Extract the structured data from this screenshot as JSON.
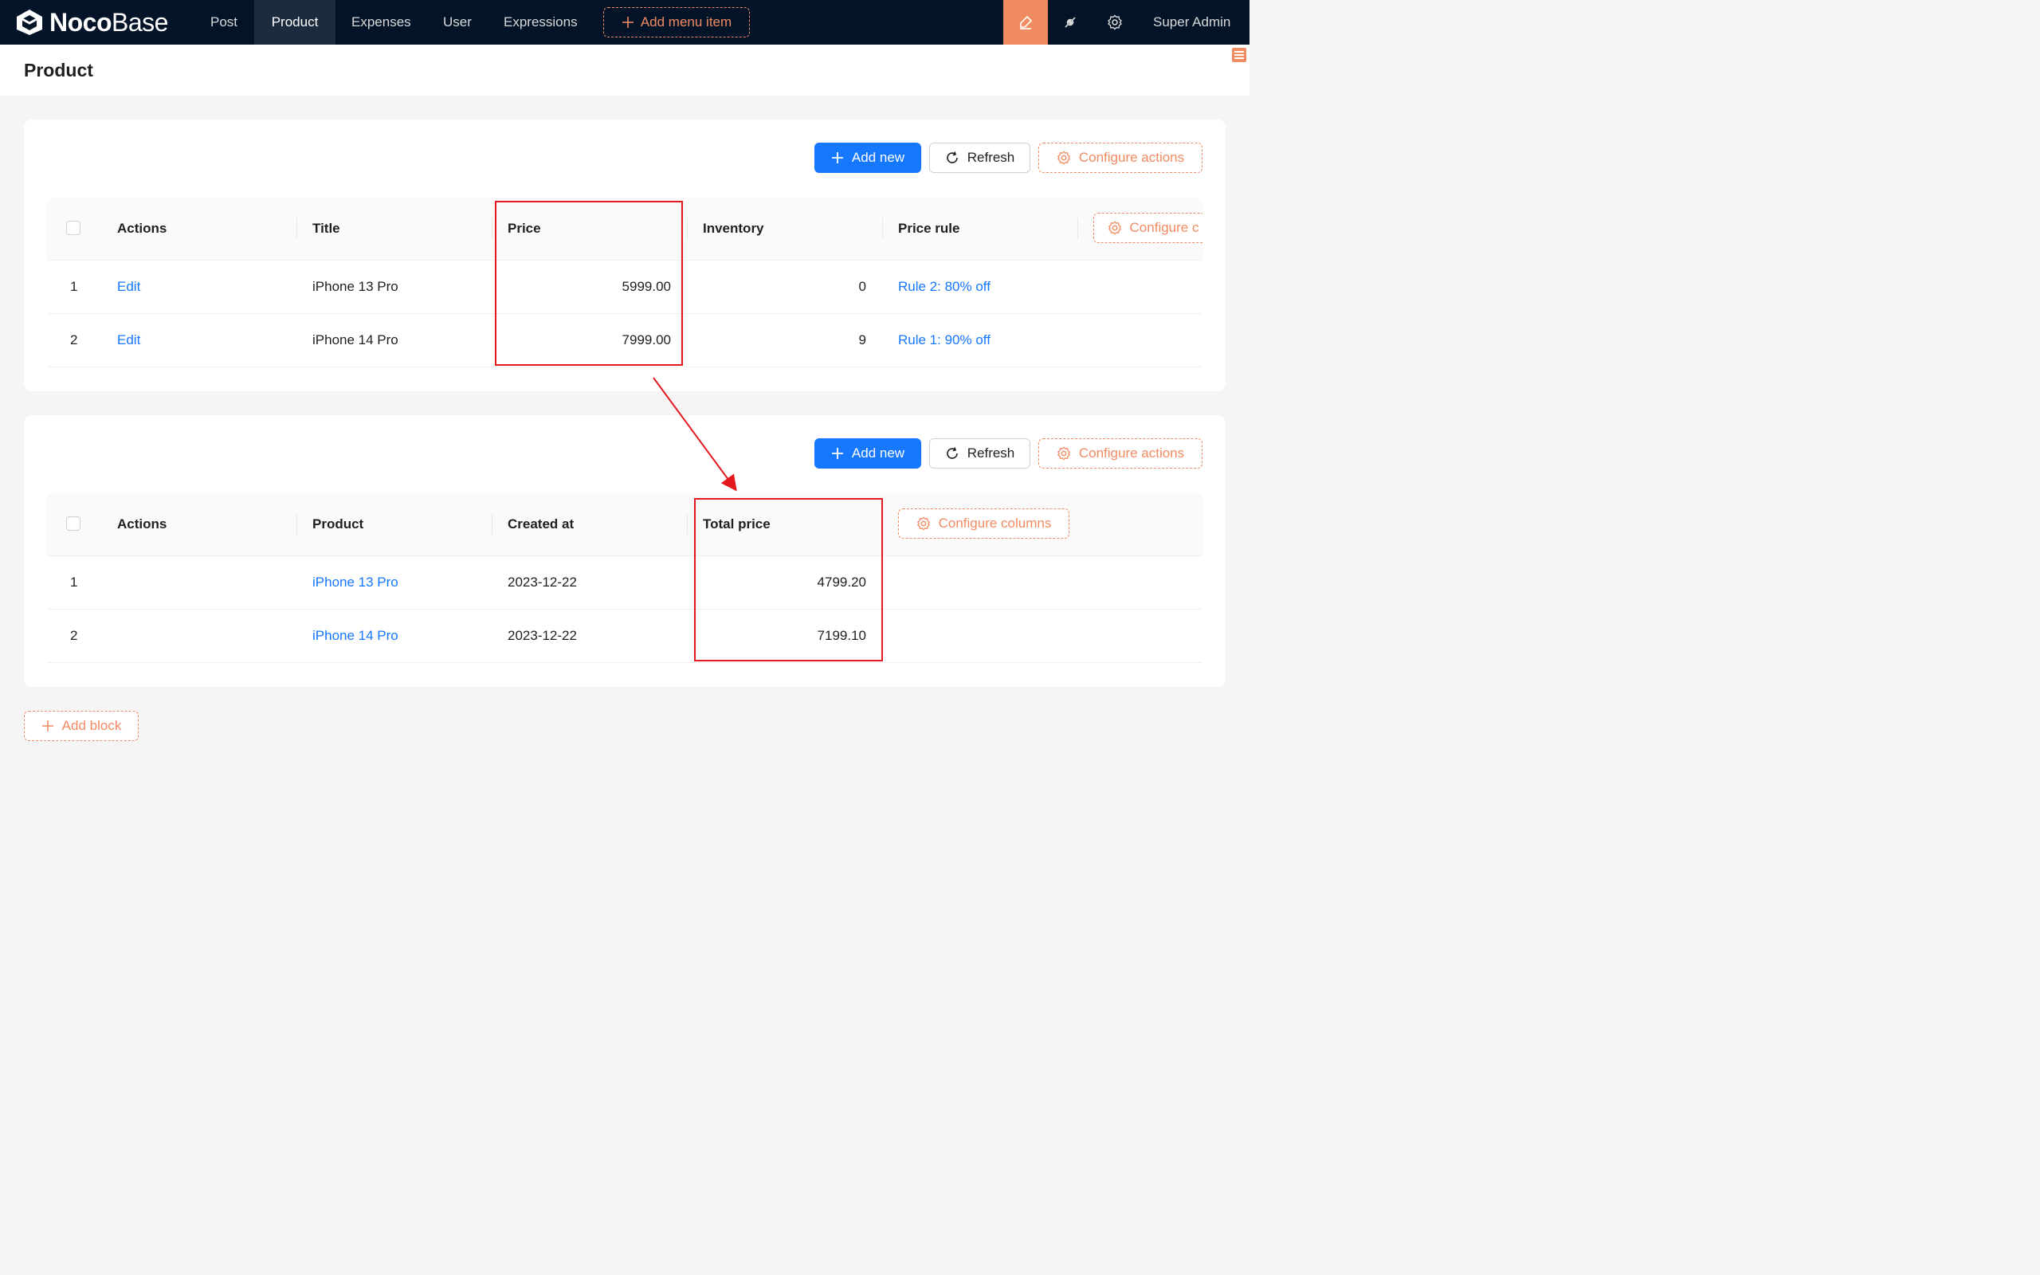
{
  "topbar": {
    "logo_bold": "Noco",
    "logo_light": "Base",
    "nav": [
      "Post",
      "Product",
      "Expenses",
      "User",
      "Expressions"
    ],
    "active_nav": "Product",
    "add_menu_label": "Add menu item",
    "user_name": "Super Admin",
    "icons": [
      "highlighter-icon",
      "plugin-icon",
      "gear-icon"
    ]
  },
  "page": {
    "title": "Product"
  },
  "product_block": {
    "actions": {
      "add_new": "Add new",
      "refresh": "Refresh",
      "configure_actions": "Configure actions"
    },
    "columns": [
      "Actions",
      "Title",
      "Price",
      "Inventory",
      "Price rule"
    ],
    "configure_columns_label": "Configure c",
    "rows": [
      {
        "index": "1",
        "action": "Edit",
        "title": "iPhone 13 Pro",
        "price": "5999.00",
        "inventory": "0",
        "price_rule": "Rule 2: 80% off"
      },
      {
        "index": "2",
        "action": "Edit",
        "title": "iPhone 14 Pro",
        "price": "7999.00",
        "inventory": "9",
        "price_rule": "Rule 1: 90% off"
      }
    ]
  },
  "order_block": {
    "actions": {
      "add_new": "Add new",
      "refresh": "Refresh",
      "configure_actions": "Configure actions"
    },
    "columns": [
      "Actions",
      "Product",
      "Created at",
      "Total price"
    ],
    "configure_columns_label": "Configure columns",
    "rows": [
      {
        "index": "1",
        "product": "iPhone 13 Pro",
        "created_at": "2023-12-22",
        "total_price": "4799.20"
      },
      {
        "index": "2",
        "product": "iPhone 14 Pro",
        "created_at": "2023-12-22",
        "total_price": "7199.10"
      }
    ]
  },
  "add_block_label": "Add block",
  "colors": {
    "accent": "#f18b62",
    "primary": "#1677ff",
    "annotation": "#e3191f",
    "topbar": "#031428"
  }
}
